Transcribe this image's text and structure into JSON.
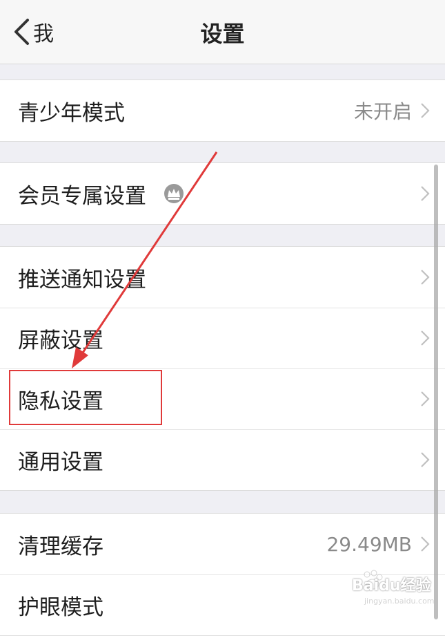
{
  "nav": {
    "back_label": "我",
    "title": "设置"
  },
  "groups": [
    {
      "items": [
        {
          "label": "青少年模式",
          "value": "未开启"
        }
      ]
    },
    {
      "items": [
        {
          "label": "会员专属设置",
          "badge_icon": "crown-icon"
        }
      ]
    },
    {
      "items": [
        {
          "label": "推送通知设置"
        },
        {
          "label": "屏蔽设置"
        },
        {
          "label": "隐私设置",
          "highlighted": true
        },
        {
          "label": "通用设置"
        }
      ]
    },
    {
      "items": [
        {
          "label": "清理缓存",
          "value": "29.49MB"
        },
        {
          "label": "护眼模式"
        }
      ]
    }
  ],
  "annotation": {
    "color": "#e03a3a",
    "target": "隐私设置"
  },
  "watermark": {
    "text": "Baidu经验",
    "subtext": "jingyan.baidu.com"
  },
  "colors": {
    "background": "#efeff4",
    "cell": "#ffffff",
    "value_text": "#8a8a8a",
    "chevron": "#c0c0c0"
  }
}
